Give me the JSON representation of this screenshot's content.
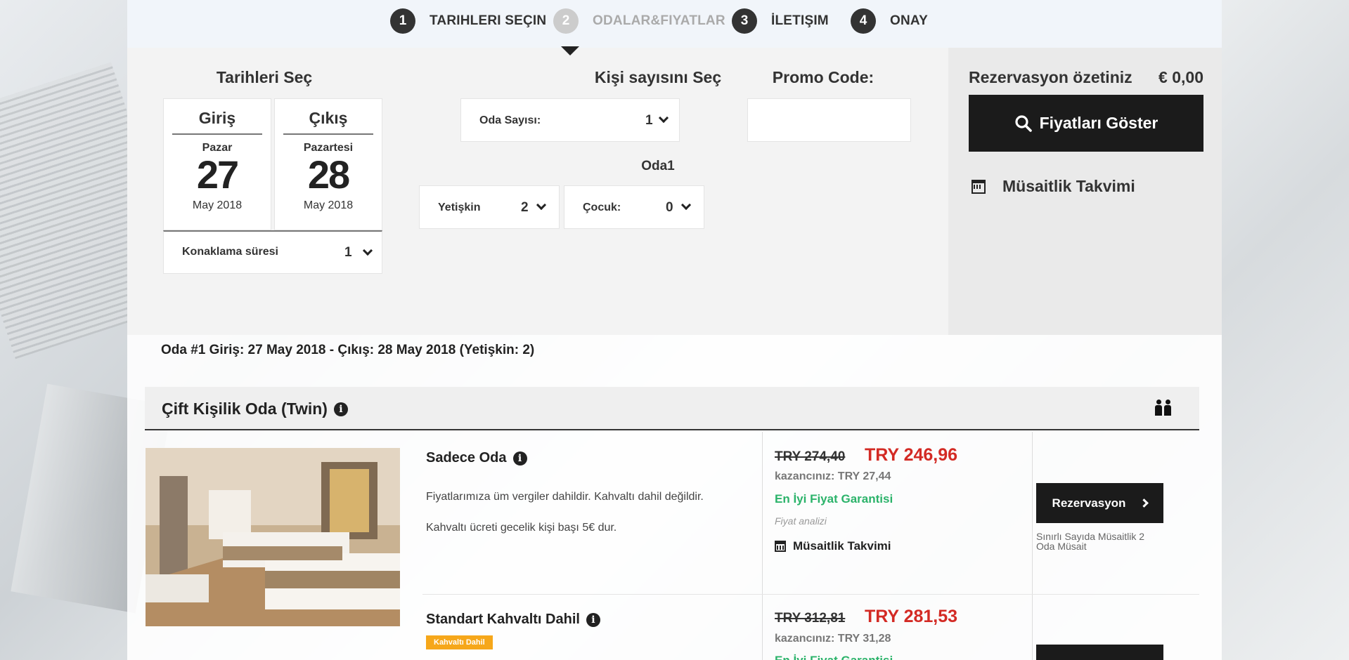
{
  "steps": [
    {
      "num": "1",
      "label": "TARIHLERI SEÇIN"
    },
    {
      "num": "2",
      "label": "ODALAR&FIYATLAR"
    },
    {
      "num": "3",
      "label": "İLETIŞIM"
    },
    {
      "num": "4",
      "label": "ONAY"
    }
  ],
  "dates": {
    "title": "Tarihleri Seç",
    "checkin": {
      "label": "Giriş",
      "weekday": "Pazar",
      "day": "27",
      "monthyear": "May 2018"
    },
    "checkout": {
      "label": "Çıkış",
      "weekday": "Pazartesi",
      "day": "28",
      "monthyear": "May 2018"
    },
    "stay_label": "Konaklama süresi",
    "stay_value": "1"
  },
  "guests": {
    "title": "Kişi sayısını Seç",
    "rooms_label": "Oda Sayısı:",
    "rooms_value": "1",
    "room_heading": "Oda1",
    "adults_label": "Yetişkin",
    "adults_value": "2",
    "children_label": "Çocuk:",
    "children_value": "0"
  },
  "promo": {
    "title": "Promo Code:",
    "value": ""
  },
  "summary": {
    "label": "Rezervasyon özetiniz",
    "amount": "€ 0,00",
    "show_prices": "Fiyatları Göster",
    "availability": "Müsaitlik Takvimi"
  },
  "room_info": "Oda #1 Giriş: 27 May 2018 - Çıkış: 28 May 2018 (Yetişkin: 2)",
  "room_type": {
    "name": "Çift Kişilik Oda (Twin)"
  },
  "rates": [
    {
      "name": "Sadece Oda",
      "desc1": "Fiyatlarımıza üm vergiler dahildir. Kahvaltı dahil değildir.",
      "desc2": "Kahvaltı ücreti gecelik kişi başı 5€ dur.",
      "old_price": "TRY 274,40",
      "new_price": "TRY 246,96",
      "saving": "kazancınız: TRY 27,44",
      "guarantee": "En İyi Fiyat Garantisi",
      "analysis": "Fiyat analizi",
      "calendar": "Müsaitlik Takvimi",
      "button": "Rezervasyon",
      "availability": "Sınırlı Sayıda Müsaitlik 2 Oda Müsait"
    },
    {
      "name": "Standart Kahvaltı Dahil",
      "badge": "Kahvaltı Dahil",
      "old_price": "TRY 312,81",
      "new_price": "TRY 281,53",
      "saving": "kazancınız: TRY 31,28",
      "guarantee": "En İyi Fiyat Garantisi"
    }
  ],
  "colors": {
    "price_red": "#d32a24",
    "guarantee_green": "#2bb36a",
    "badge_orange": "#f6a71a",
    "dark": "#1b1b1b"
  }
}
